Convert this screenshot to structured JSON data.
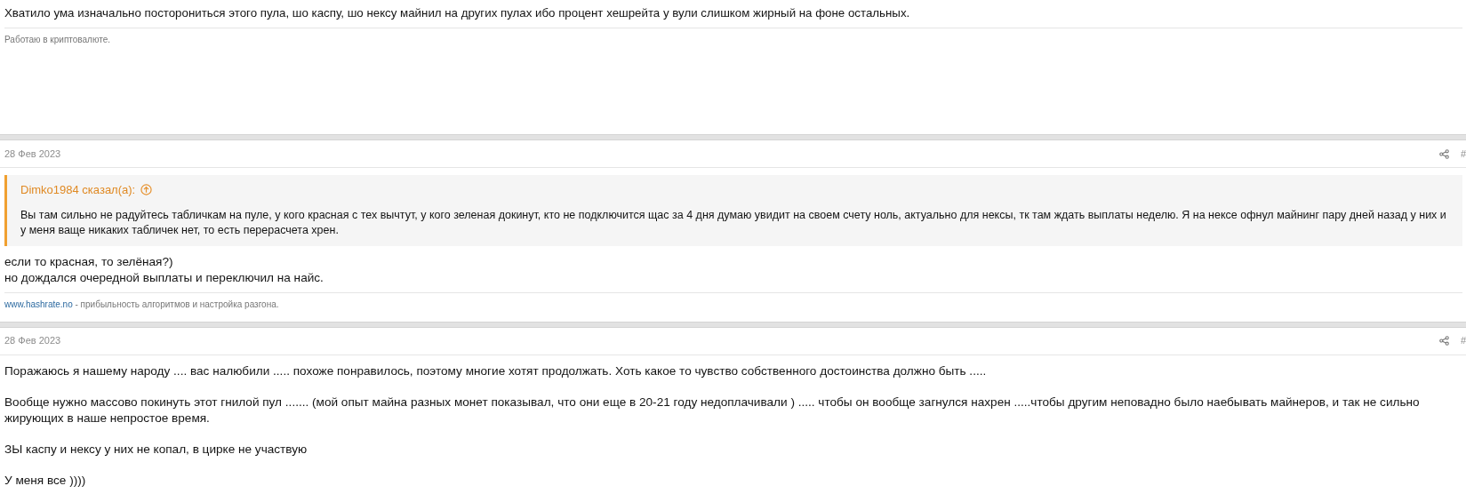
{
  "posts": [
    {
      "body": [
        "Хватило ума изначально посторониться этого пула, шо каспу, шо нексу майнил на других пулах ибо процент хешрейта у вули слишком жирный на фоне остальных."
      ],
      "signature": {
        "text": "Работаю в криптовалюте."
      }
    },
    {
      "date": "28 Фев 2023",
      "number": "#",
      "quote": {
        "author": "Dimko1984 сказал(а):",
        "text": "Вы там сильно не радуйтесь табличкам на пуле, у кого красная с тех вычтут, у кого зеленая докинут, кто не подключится щас за 4 дня думаю увидит на своем счету ноль, актуально для нексы, тк там ждать выплаты неделю. Я на нексе офнул майнинг пару дней назад у них и у меня ваще никаких табличек нет, то есть перерасчета хрен."
      },
      "body": [
        "если то красная, то зелёная?)\nно дождался очередной выплаты и переключил на найс."
      ],
      "signature": {
        "link": "www.hashrate.no",
        "text": " - прибыльность алгоритмов и настройка разгона."
      }
    },
    {
      "date": "28 Фев 2023",
      "number": "#",
      "body": [
        "Поражаюсь я нашему народу .... вас налюбили ..... похоже понравилось, поэтому многие хотят продолжать. Хоть какое то чувство собственного достоинства должно быть .....",
        "Вообще нужно массово покинуть этот гнилой пул ....... (мой опыт майна разных монет показывал, что они еще в 20-21 году недоплачивали ) ..... чтобы он вообще загнулся нахрен .....чтобы другим неповадно было наебывать майнеров, и так не сильно жирующих в наше непростое время.",
        "ЗЫ каспу и нексу у них не копал, в цирке не участвую",
        "У меня все ))))"
      ]
    }
  ]
}
